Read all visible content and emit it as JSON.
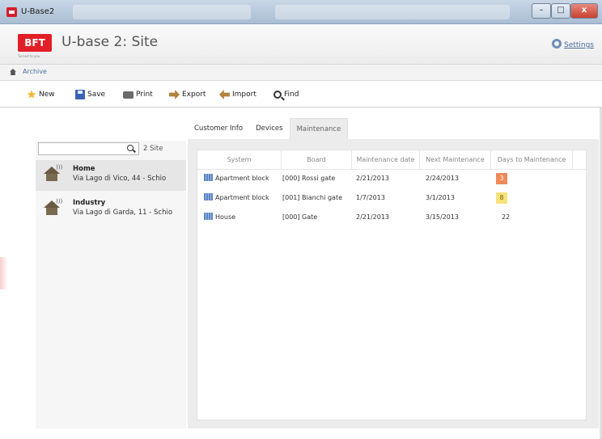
{
  "window": {
    "title": "U-Base2",
    "minimize": "–",
    "maximize": "□",
    "close": "x"
  },
  "header": {
    "logo_text": "BFT",
    "tagline": "Turned to you",
    "app_title": "U-base 2: Site",
    "settings_label": "Settings"
  },
  "breadcrumb": {
    "label": "Archive"
  },
  "toolbar": {
    "new_label": "New",
    "save_label": "Save",
    "print_label": "Print",
    "export_label": "Export",
    "import_label": "Import",
    "find_label": "Find"
  },
  "sidebar": {
    "search_placeholder": "",
    "site_count": "2 Site",
    "sites": [
      {
        "name": "Home",
        "address": "Via Lago di Vico, 44 - Schio",
        "icon": "house-icon"
      },
      {
        "name": "Industry",
        "address": "Via Lago di Garda, 11 - Schio",
        "icon": "house-icon"
      }
    ]
  },
  "tabs": [
    "Customer Info",
    "Devices",
    "Maintenance"
  ],
  "active_tab": "Maintenance",
  "table": {
    "columns": [
      "System",
      "Board",
      "Maintenance date",
      "Next Maintenance",
      "Days to Maintenance"
    ],
    "rows": [
      {
        "system": "Apartment block",
        "board": "[000] Rossi gate",
        "maintenance_date": "2/21/2013",
        "next_maintenance": "2/24/2013",
        "days": "3",
        "days_status": "red"
      },
      {
        "system": "Apartment block",
        "board": "[001] Bianchi gate",
        "maintenance_date": "1/7/2013",
        "next_maintenance": "3/1/2013",
        "days": "8",
        "days_status": "yellow"
      },
      {
        "system": "House",
        "board": "[000] Gate",
        "maintenance_date": "2/21/2013",
        "next_maintenance": "3/15/2013",
        "days": "22",
        "days_status": "none"
      }
    ]
  },
  "colors": {
    "brand": "#e21f26",
    "link": "#4a6ea0",
    "badge_red": "#ef8a5a",
    "badge_yellow": "#f7e27b"
  }
}
